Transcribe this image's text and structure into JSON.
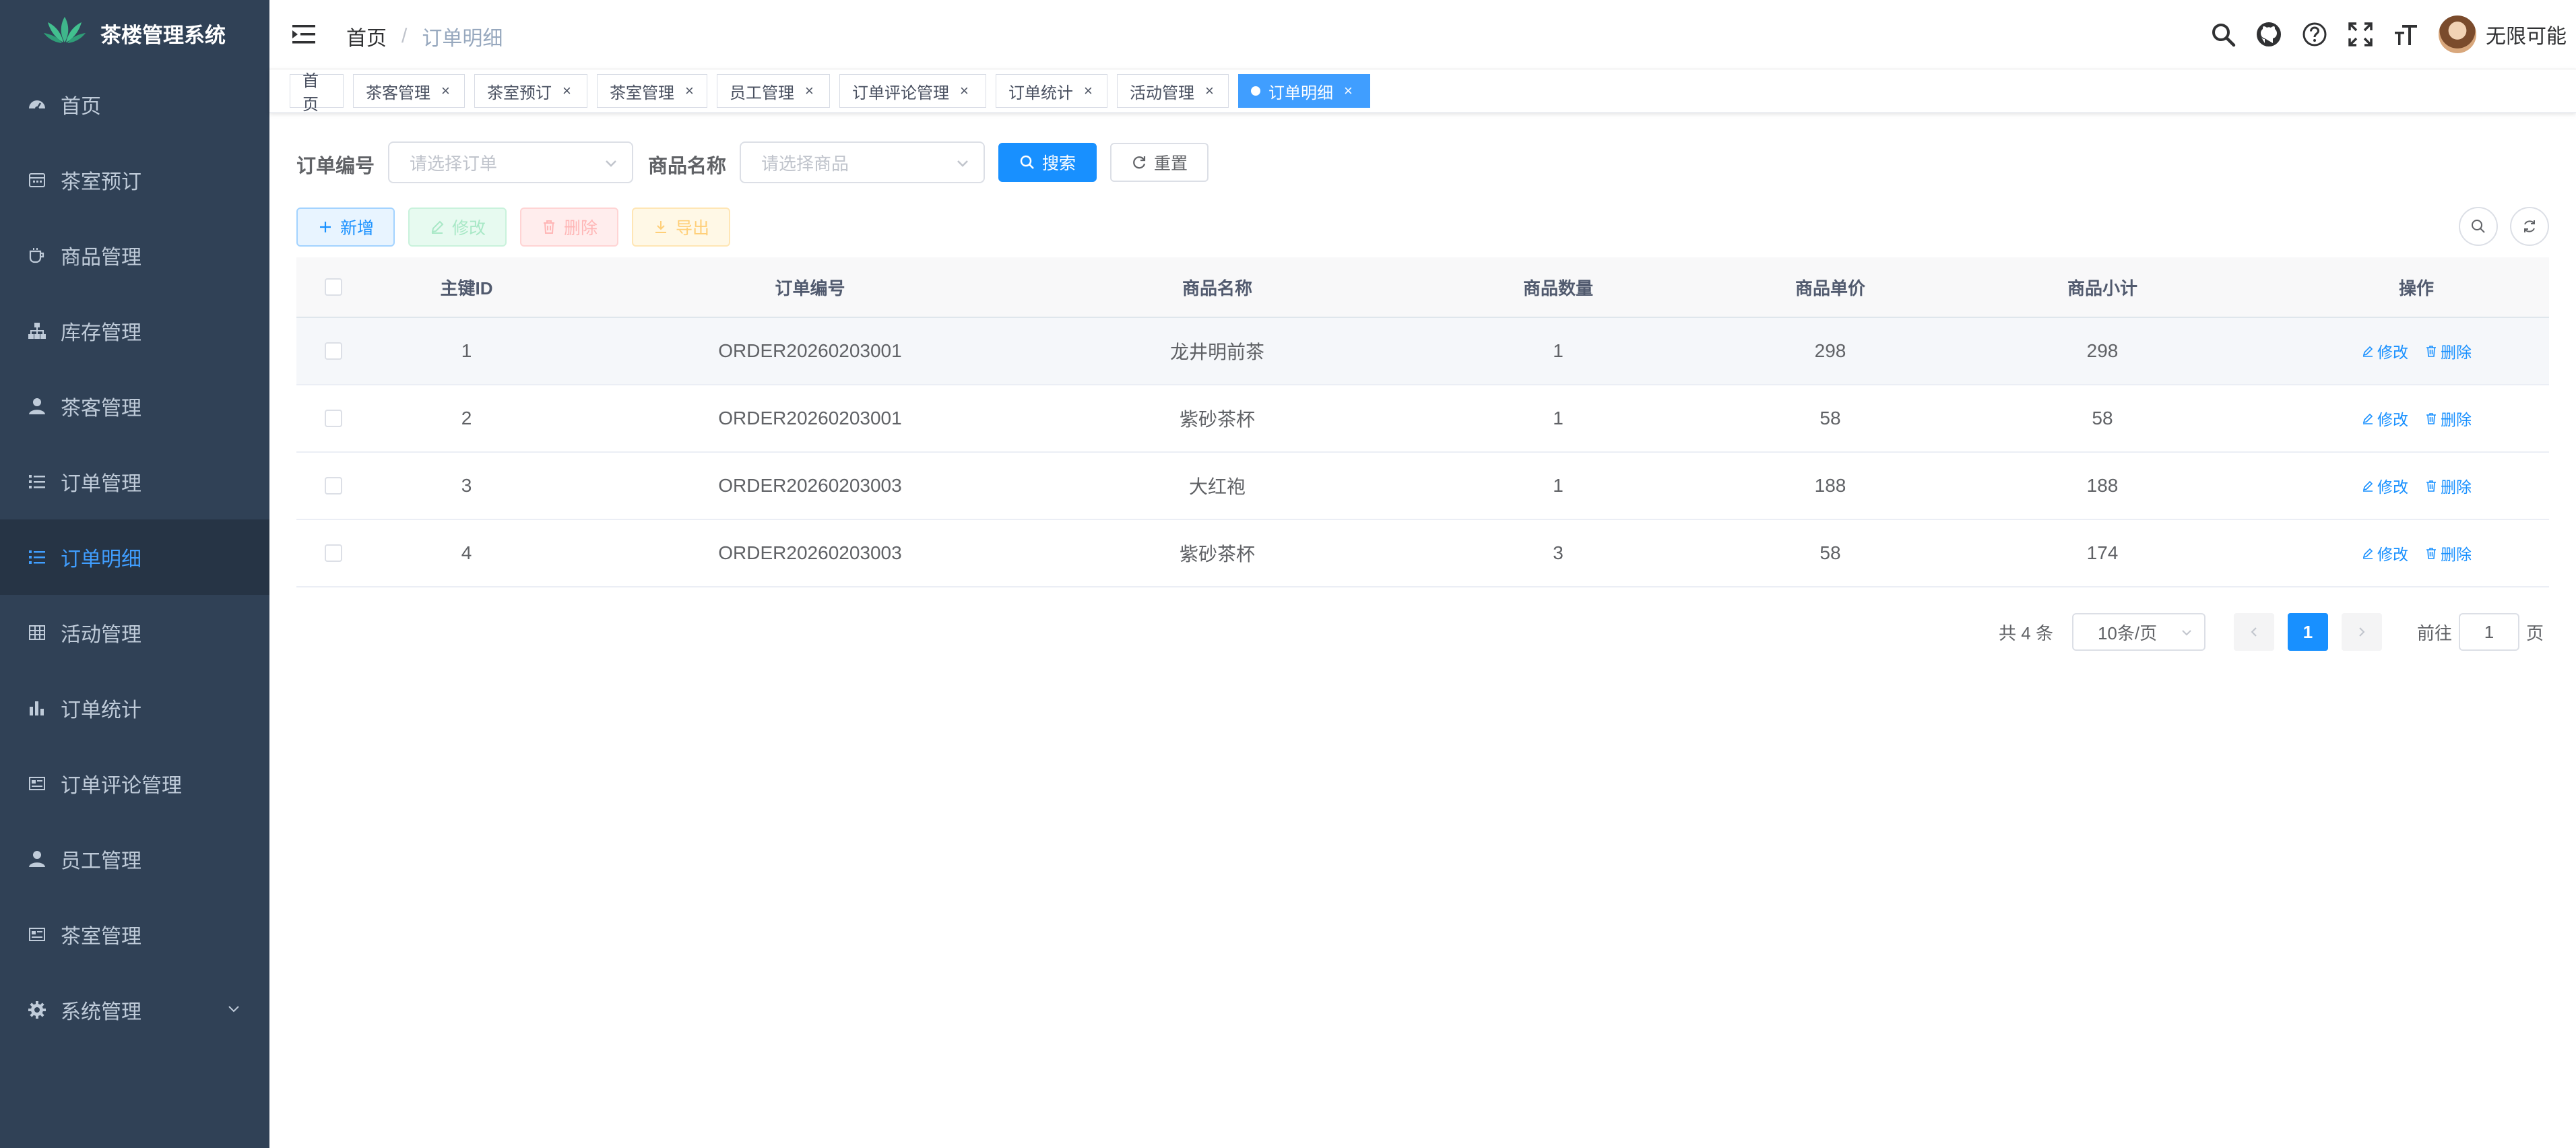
{
  "app": {
    "title": "茶楼管理系统"
  },
  "sidebar": {
    "items": [
      {
        "label": "首页",
        "icon": "dashboard-icon"
      },
      {
        "label": "茶室预订",
        "icon": "calendar-icon"
      },
      {
        "label": "商品管理",
        "icon": "cup-icon"
      },
      {
        "label": "库存管理",
        "icon": "tree-icon"
      },
      {
        "label": "茶客管理",
        "icon": "user-icon"
      },
      {
        "label": "订单管理",
        "icon": "list-icon"
      },
      {
        "label": "订单明细",
        "icon": "list-icon",
        "active": true
      },
      {
        "label": "活动管理",
        "icon": "table-icon"
      },
      {
        "label": "订单统计",
        "icon": "chart-icon"
      },
      {
        "label": "订单评论管理",
        "icon": "form-icon"
      },
      {
        "label": "员工管理",
        "icon": "user-icon"
      },
      {
        "label": "茶室管理",
        "icon": "form-icon"
      },
      {
        "label": "系统管理",
        "icon": "gear-icon",
        "has_children": true
      }
    ]
  },
  "header": {
    "breadcrumb": [
      "首页",
      "/",
      "订单明细"
    ],
    "username": "无限可能"
  },
  "tags": [
    {
      "label": "首页",
      "closable": false
    },
    {
      "label": "茶客管理",
      "closable": true
    },
    {
      "label": "茶室预订",
      "closable": true
    },
    {
      "label": "茶室管理",
      "closable": true
    },
    {
      "label": "员工管理",
      "closable": true
    },
    {
      "label": "订单评论管理",
      "closable": true
    },
    {
      "label": "订单统计",
      "closable": true
    },
    {
      "label": "活动管理",
      "closable": true
    },
    {
      "label": "订单明细",
      "closable": true,
      "active": true
    }
  ],
  "close_symbol": "×",
  "search": {
    "order_label": "订单编号",
    "order_placeholder": "请选择订单",
    "product_label": "商品名称",
    "product_placeholder": "请选择商品",
    "search_btn": "搜索",
    "reset_btn": "重置"
  },
  "toolbar": {
    "add": "新增",
    "edit": "修改",
    "delete": "删除",
    "export": "导出"
  },
  "table": {
    "columns": [
      "主键ID",
      "订单编号",
      "商品名称",
      "商品数量",
      "商品单价",
      "商品小计",
      "操作"
    ],
    "rows": [
      [
        "1",
        "ORDER20260203001",
        "龙井明前茶",
        "1",
        "298",
        "298"
      ],
      [
        "2",
        "ORDER20260203001",
        "紫砂茶杯",
        "1",
        "58",
        "58"
      ],
      [
        "3",
        "ORDER20260203003",
        "大红袍",
        "1",
        "188",
        "188"
      ],
      [
        "4",
        "ORDER20260203003",
        "紫砂茶杯",
        "3",
        "58",
        "174"
      ]
    ],
    "edit_link": "修改",
    "delete_link": "删除"
  },
  "pagination": {
    "total": "共 4 条",
    "page_size": "10条/页",
    "current": "1",
    "goto_prefix": "前往",
    "goto_value": "1",
    "goto_suffix": "页"
  },
  "colors": {
    "sidebar_bg": "#304156",
    "accent": "#1890ff",
    "active_menu_text": "#409eff"
  }
}
